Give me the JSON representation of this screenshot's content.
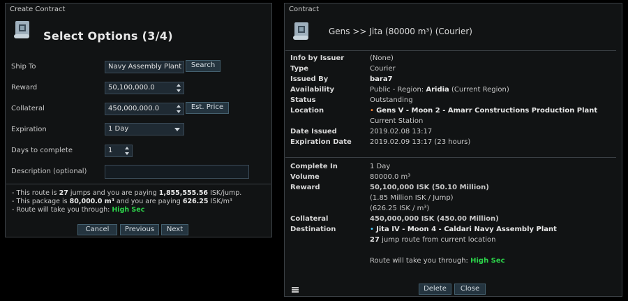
{
  "create_contract": {
    "window_title": "Create Contract",
    "heading": "Select Options (3/4)",
    "fields": {
      "ship_to_label": "Ship To",
      "ship_to_value": "Navy Assembly Plant",
      "search_button": "Search",
      "reward_label": "Reward",
      "reward_value": "50,100,000.0",
      "collateral_label": "Collateral",
      "collateral_value": "450,000,000.0",
      "est_price_button": "Est. Price",
      "expiration_label": "Expiration",
      "expiration_value": "1 Day",
      "days_label": "Days to complete",
      "days_value": "1",
      "description_label": "Description (optional)",
      "description_value": ""
    },
    "notes": {
      "line1_prefix": "- This route is ",
      "line1_jumps": "27",
      "line1_mid": " jumps and you are paying ",
      "line1_amount": "1,855,555.56",
      "line1_suffix": " ISK/jump.",
      "line2_prefix": "- This package is ",
      "line2_volume": "80,000.0 m³",
      "line2_mid": " and you are paying ",
      "line2_amount": "626.25",
      "line2_suffix": " ISK/m³",
      "line3_prefix": "- Route will take you through: ",
      "line3_security": "High Sec"
    },
    "buttons": {
      "cancel": "Cancel",
      "previous": "Previous",
      "next": "Next"
    }
  },
  "contract": {
    "window_title": "Contract",
    "heading": "Gens >> Jita (80000 m³) (Courier)",
    "info": {
      "info_by_issuer_label": "Info by Issuer",
      "info_by_issuer_value": "(None)",
      "type_label": "Type",
      "type_value": "Courier",
      "issued_by_label": "Issued By",
      "issued_by_value": "bara7",
      "availability_label": "Availability",
      "availability_prefix": "Public - Region: ",
      "availability_region": "Aridia",
      "availability_suffix": " (Current Region)",
      "status_label": "Status",
      "status_value": "Outstanding",
      "location_label": "Location",
      "location_value": "Gens V - Moon 2 - Amarr Constructions Production Plant",
      "location_sub": "Current Station",
      "date_issued_label": "Date Issued",
      "date_issued_value": "2019.02.08 13:17",
      "expiration_label": "Expiration Date",
      "expiration_value": "2019.02.09 13:17 (23 hours)"
    },
    "details": {
      "complete_in_label": "Complete In",
      "complete_in_value": "1 Day",
      "volume_label": "Volume",
      "volume_value": "80000.0 m³",
      "reward_label": "Reward",
      "reward_value": "50,100,000 ISK (50.10 Million)",
      "reward_sub1": "(1.85 Million ISK / Jump)",
      "reward_sub2": "(626.25 ISK / m³)",
      "collateral_label": "Collateral",
      "collateral_value": "450,000,000 ISK (450.00 Million)",
      "destination_label": "Destination",
      "destination_value": "Jita IV - Moon 4 - Caldari Navy Assembly Plant",
      "route_jumps": "27",
      "route_text": " jump route from current location",
      "route_security_prefix": "Route will take you through: ",
      "route_security": "High Sec"
    },
    "buttons": {
      "delete": "Delete",
      "close": "Close"
    }
  },
  "colors": {
    "green": "#2cd34a",
    "red": "#e23a3a",
    "accent_button": "#24343f"
  }
}
